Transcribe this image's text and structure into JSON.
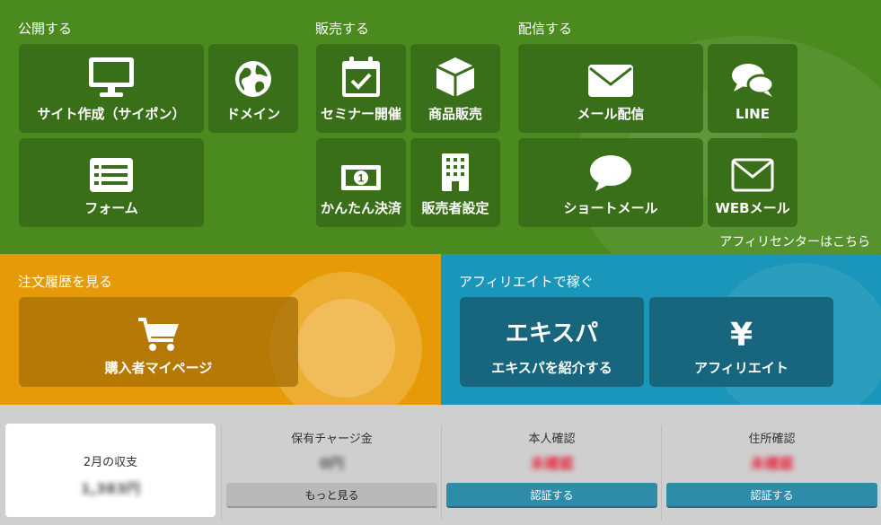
{
  "publish": {
    "title": "公開する",
    "site_label": "サイト作成（サイポン）",
    "domain_label": "ドメイン",
    "form_label": "フォーム"
  },
  "sell": {
    "title": "販売する",
    "seminar_label": "セミナー開催",
    "product_label": "商品販売",
    "payment_label": "かんたん決済",
    "seller_label": "販売者設定"
  },
  "deliver": {
    "title": "配信する",
    "mail_label": "メール配信",
    "line_label": "LINE",
    "short_mail_label": "ショートメール",
    "web_mail_label": "WEBメール"
  },
  "affiliate_center_link": "アフィリセンターはこちら",
  "orders": {
    "title": "注文履歴を見る",
    "buyer_page_label": "購入者マイページ"
  },
  "affiliate": {
    "title": "アフィリエイトで稼ぐ",
    "expa_big": "エキスパ",
    "expa_label": "エキスパを紹介する",
    "yen_symbol": "¥",
    "affiliate_label": "アフィリエイト"
  },
  "status": {
    "income_title": "2月の収支",
    "income_value": "1,383円",
    "charge_title": "保有チャージ金",
    "charge_value": "0円",
    "charge_button": "もっと見る",
    "identity_title": "本人確認",
    "identity_value": "未確認",
    "identity_button": "認証する",
    "address_title": "住所確認",
    "address_value": "未確認",
    "address_button": "認証する"
  },
  "colors": {
    "green": "#4a8a1f",
    "orange": "#e69a08",
    "blue": "#1996b9",
    "unverified": "#e8223a"
  }
}
